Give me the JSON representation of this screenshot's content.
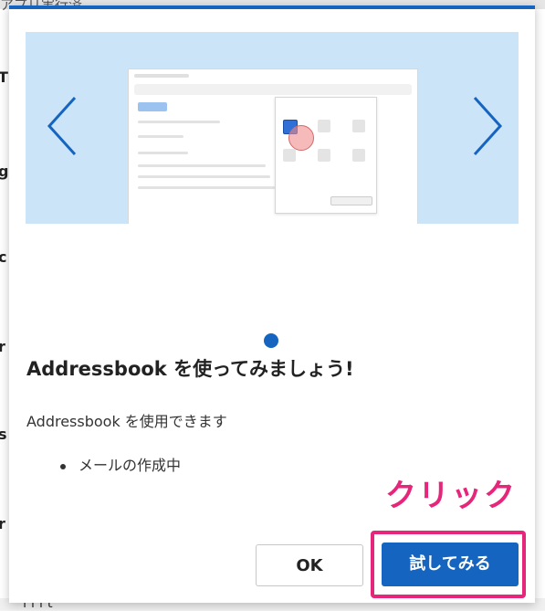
{
  "background": {
    "top_text": "アプリ実行済",
    "fragments": [
      "T",
      "g",
      "c",
      "r",
      "s",
      "r"
    ],
    "bottom_text": "l i  l t"
  },
  "dialog": {
    "carousel": {
      "prev_icon": "chevron-left-icon",
      "next_icon": "chevron-right-icon",
      "page_count": 1,
      "current_page": 1
    },
    "title": "Addressbook を使ってみましょう!",
    "description": "Addressbook を使用できます",
    "bullets": [
      "メールの作成中"
    ],
    "annotation": "クリック",
    "buttons": {
      "ok": "OK",
      "try": "試してみる"
    }
  },
  "colors": {
    "accent": "#1565c0",
    "carousel_bg": "#cce4f7",
    "annotation": "#e5267a"
  }
}
